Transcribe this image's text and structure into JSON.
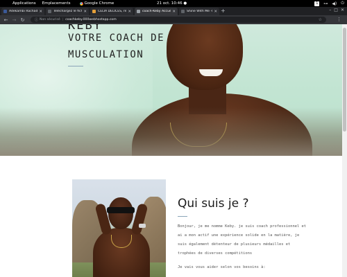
{
  "os_panel": {
    "applications": "Applications",
    "places": "Emplacements",
    "active_app": "Google Chrome",
    "clock": "21 oct.  10:46 ●",
    "workspace": "1"
  },
  "tabs": [
    {
      "title": "Adekambi Rachad, le dé",
      "favicon_color": "#3b5998"
    },
    {
      "title": "Téléchargez le fichier « ",
      "favicon_color": "#5f6368"
    },
    {
      "title": "CELIA DELICES, restaura",
      "favicon_color": "#e5a03a"
    },
    {
      "title": "coach-Keby Accueil",
      "favicon_color": "#5f6368"
    },
    {
      "title": "Shine With Me -le make",
      "favicon_color": "#5f6368"
    }
  ],
  "address_bar": {
    "security_label": "Non sécurisé",
    "url": "coachkeby.000webhostapp.com"
  },
  "hero": {
    "partial_title": "KEBY",
    "title": "VOTRE COACH DE",
    "subtitle": "MUSCULATION"
  },
  "about": {
    "heading": "Qui suis je ?",
    "lines": [
      "Bonjour, je me nomme Keby. je suis coach professionnel et",
      "ai a mon actif une expérience solide en la matière, je",
      "suis également détenteur de plusieurs médailles et",
      "trophées de diverses compétitions"
    ],
    "last_line": "Je vais vous aider selon vos besoins à:"
  },
  "colors": {
    "os_bar": "#000000",
    "tab_strip": "#202124",
    "toolbar": "#35363a",
    "hero_bg": "#c3e5d3",
    "accent_underline": "#8aa4b8"
  },
  "icons": {
    "back": "arrow-left-icon",
    "forward": "arrow-right-icon",
    "reload": "reload-icon",
    "home": "home-icon",
    "lock": "info-icon",
    "bookmark": "star-icon",
    "menu": "kebab-menu-icon"
  }
}
